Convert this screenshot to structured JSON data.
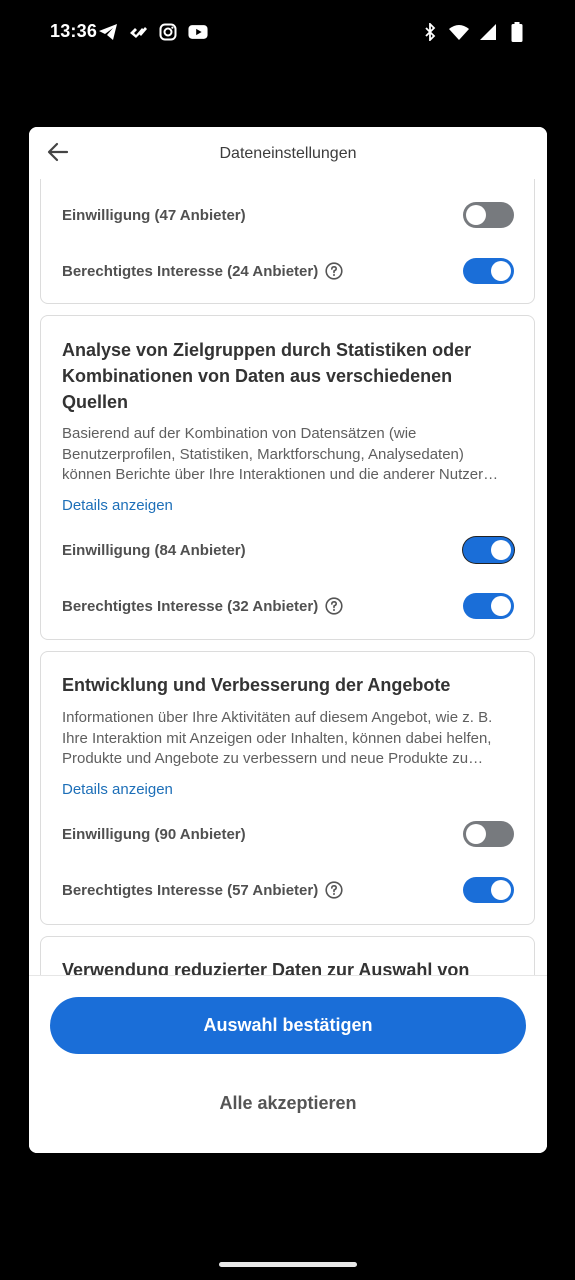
{
  "status_bar": {
    "time": "13:36",
    "left_icons": [
      "telegram-icon",
      "app-icon",
      "instagram-icon",
      "youtube-icon"
    ],
    "right_icons": [
      "bluetooth-icon",
      "wifi-icon",
      "signal-icon",
      "battery-icon"
    ]
  },
  "dialog": {
    "title": "Dateneinstellungen",
    "back_icon": "arrow-left-icon"
  },
  "cards": [
    {
      "consent_label": "Einwilligung (47 Anbieter)",
      "consent_on": false,
      "interest_label": "Berechtigtes Interesse (24 Anbieter)",
      "interest_on": true
    },
    {
      "title": "Analyse von Zielgruppen durch Statistiken oder Kombinationen von Daten aus verschiedenen Quellen",
      "description": "Basierend auf der Kombination von Datensätzen (wie Benutzerprofilen, Statistiken, Marktforschung, Analysedaten) können Berichte über Ihre Interaktionen und die anderer Nutzer erstellt werden.",
      "details_label": "Details anzeigen",
      "consent_label": "Einwilligung (84 Anbieter)",
      "consent_on": true,
      "interest_label": "Berechtigtes Interesse (32 Anbieter)",
      "interest_on": true
    },
    {
      "title": "Entwicklung und Verbesserung der Angebote",
      "description": "Informationen über Ihre Aktivitäten auf diesem Angebot, wie z. B. Ihre Interaktion mit Anzeigen oder Inhalten, können dabei helfen, Produkte und Angebote zu verbessern und neue Produkte zu entwickeln.",
      "details_label": "Details anzeigen",
      "consent_label": "Einwilligung (90 Anbieter)",
      "consent_on": false,
      "interest_label": "Berechtigtes Interesse (57 Anbieter)",
      "interest_on": true
    },
    {
      "title": "Verwendung reduzierter Daten zur Auswahl von"
    }
  ],
  "footer": {
    "confirm_label": "Auswahl bestätigen",
    "accept_all_label": "Alle akzeptieren"
  },
  "colors": {
    "accent": "#1a6ed8",
    "toggle_off": "#777a7e",
    "link": "#1d6fb8"
  }
}
